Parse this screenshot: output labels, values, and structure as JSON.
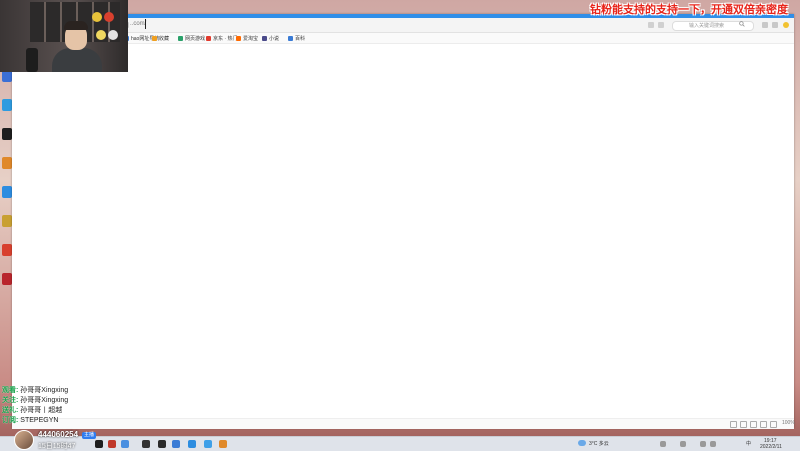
{
  "overlay": {
    "banner": "钻粉能支持的支持一下，开通双倍亲密度"
  },
  "browser": {
    "url_partial": "..com/",
    "search_placeholder": "输入关键词搜索",
    "bookmarks": [
      {
        "label": "hao网址导航",
        "color": "#3a7bd5"
      },
      {
        "label": "收藏",
        "color": "#f0a020"
      },
      {
        "label": "网页游戏",
        "color": "#2aa16a"
      },
      {
        "label": "京东 · 热门",
        "color": "#e23b2e"
      },
      {
        "label": "爱淘宝",
        "color": "#ff6a00"
      },
      {
        "label": "小说",
        "color": "#4a4a8a"
      },
      {
        "label": "百科",
        "color": "#3a7bd5"
      }
    ],
    "zoom": "100%",
    "accent_color": "#2f8ee8"
  },
  "chat": [
    {
      "user": "观看:",
      "text": "孙哥哥Xingxing"
    },
    {
      "user": "关注:",
      "text": "孙哥哥Xingxing"
    },
    {
      "user": "送礼:",
      "text": "孙哥哥丨超越"
    },
    {
      "user": "订阅:",
      "text": "STEPEGYN"
    }
  ],
  "streamer": {
    "id": "444060254",
    "tag": "主播",
    "date_line": "15日15时47"
  },
  "taskbar": {
    "weather": "3°C 多云",
    "lang": "中",
    "time": "19:17",
    "date": "2022/2/11"
  }
}
